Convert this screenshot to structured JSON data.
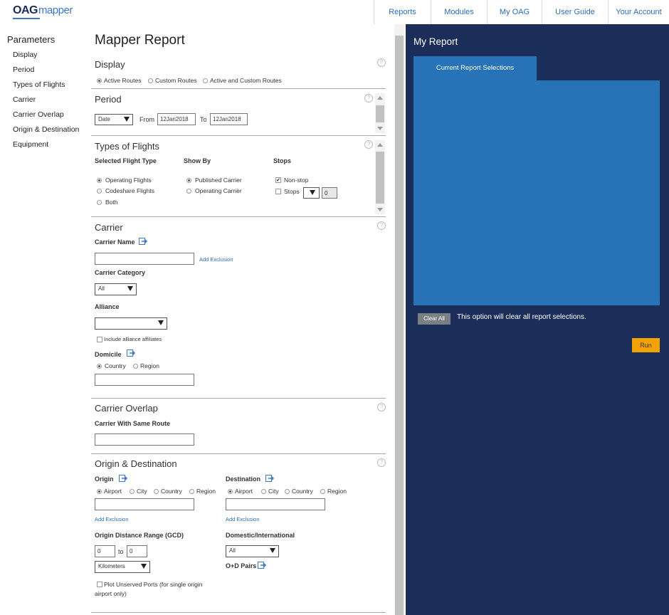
{
  "app": {
    "logo_oag": "OAG",
    "logo_mapper": "mapper"
  },
  "nav": [
    {
      "label": "Reports"
    },
    {
      "label": "Modules"
    },
    {
      "label": "My OAG"
    },
    {
      "label": "User Guide"
    },
    {
      "label": "Your Account"
    }
  ],
  "sidebar": {
    "title": "Parameters",
    "items": [
      {
        "label": "Display"
      },
      {
        "label": "Period"
      },
      {
        "label": "Types of Flights"
      },
      {
        "label": "Carrier"
      },
      {
        "label": "Carrier Overlap"
      },
      {
        "label": "Origin & Destination"
      },
      {
        "label": "Equipment"
      }
    ]
  },
  "main": {
    "title": "Mapper Report",
    "help": "?",
    "display": {
      "title": "Display",
      "options": [
        {
          "label": "Active Routes",
          "selected": true
        },
        {
          "label": "Custom Routes",
          "selected": false
        },
        {
          "label": "Active and Custom Routes",
          "selected": false
        }
      ]
    },
    "period": {
      "title": "Period",
      "type_value": "Date",
      "from_label": "From",
      "from_value": "12Jan2018",
      "to_label": "To",
      "to_value": "12Jan2018"
    },
    "types_of_flights": {
      "title": "Types of Flights",
      "col1_title": "Selected Flight Type",
      "col2_title": "Show By",
      "col3_title": "Stops",
      "flight_types": [
        {
          "label": "Operating Flights",
          "selected": true
        },
        {
          "label": "Codeshare Flights",
          "selected": false
        },
        {
          "label": "Both",
          "selected": false
        }
      ],
      "show_by": [
        {
          "label": "Published Carrier",
          "selected": true
        },
        {
          "label": "Operating Carrier",
          "selected": false
        }
      ],
      "nonstop_label": "Non-stop",
      "nonstop_checked": true,
      "nonstop_mark": "✔",
      "stops_label": "Stops",
      "stops_value": "0"
    },
    "carrier": {
      "title": "Carrier",
      "name_label": "Carrier Name",
      "add_exclusion": "Add Exclusion",
      "category_label": "Carrier Category",
      "category_value": "All",
      "alliance_label": "Alliance",
      "alliance_value": "",
      "include_affiliates": "Include alliance affiliates",
      "domicile_label": "Domicile",
      "domicile_options": [
        {
          "label": "Country",
          "selected": true
        },
        {
          "label": "Region",
          "selected": false
        }
      ]
    },
    "carrier_overlap": {
      "title": "Carrier Overlap",
      "same_route_label": "Carrier With Same Route"
    },
    "od": {
      "title": "Origin & Destination",
      "origin_label": "Origin",
      "destination_label": "Destination",
      "origin_options": [
        {
          "label": "Airport",
          "selected": true
        },
        {
          "label": "City",
          "selected": false
        },
        {
          "label": "Country",
          "selected": false
        },
        {
          "label": "Region",
          "selected": false
        }
      ],
      "destination_options": [
        {
          "label": "Airport",
          "selected": true
        },
        {
          "label": "City",
          "selected": false
        },
        {
          "label": "Country",
          "selected": false
        },
        {
          "label": "Region",
          "selected": false
        }
      ],
      "add_exclusion": "Add Exclusion",
      "distance_label": "Origin Distance Range (GCD)",
      "distance_from": "0",
      "distance_to_label": "to",
      "distance_to": "0",
      "unit_value": "Kilometers",
      "dom_int_label": "Domestic/International",
      "dom_int_value": "All",
      "od_pairs_label": "O+D Pairs",
      "unserved_label_1": "Plot Unserved Ports (for single origin",
      "unserved_label_2": "airport only)"
    }
  },
  "report": {
    "title": "My Report",
    "tab_label": "Current Report Selections",
    "clear_button": "Clear All",
    "clear_message": "This option will clear all report selections.",
    "run_button": "Run"
  },
  "colors": {
    "panel_bg": "#1b2e5a",
    "panel_accent": "#2872b8",
    "run_button": "#f3a200",
    "link": "#2a6db8"
  }
}
